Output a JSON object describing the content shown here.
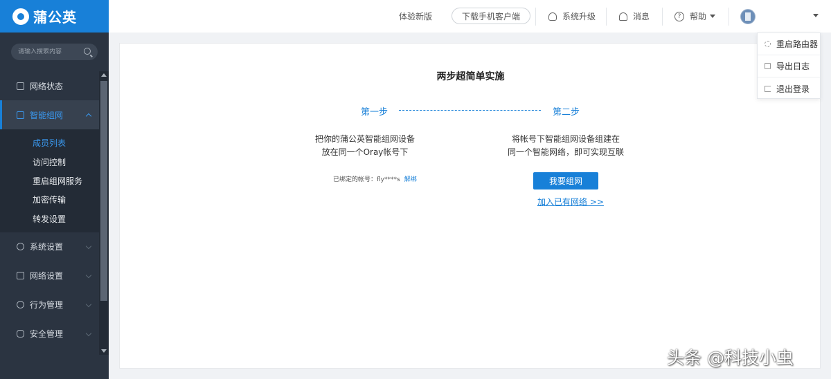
{
  "sidebar": {
    "logo_text": "蒲公英",
    "search_placeholder": "请输入搜索内容",
    "nav": [
      {
        "label": "网络状态",
        "icon": "network-status-icon"
      },
      {
        "label": "智能组网",
        "icon": "smart-network-icon",
        "active": true
      },
      {
        "label": "系统设置",
        "icon": "gear-icon"
      },
      {
        "label": "网络设置",
        "icon": "network-settings-icon"
      },
      {
        "label": "行为管理",
        "icon": "behavior-icon"
      },
      {
        "label": "安全管理",
        "icon": "security-icon"
      }
    ],
    "subnav": [
      "成员列表",
      "访问控制",
      "重启组网服务",
      "加密传输",
      "转发设置"
    ]
  },
  "header": {
    "new_version": "体验新版",
    "download_client": "下载手机客户端",
    "upgrade": "系统升级",
    "messages": "消息",
    "help": "帮助"
  },
  "dropdown": {
    "items": [
      "重启路由器",
      "导出日志",
      "退出登录"
    ]
  },
  "main": {
    "title": "两步超简单实施",
    "step1": "第一步",
    "step2": "第二步",
    "step1_line1": "把你的蒲公英智能组网设备",
    "step1_line2": "放在同一个Oray帐号下",
    "step2_line1": "将帐号下智能组网设备组建在",
    "step2_line2": "同一个智能网络，即可实现互联",
    "bound_label": "已绑定的帐号：fly****s",
    "unbind_link": "解绑",
    "create_button": "我要组网",
    "join_link": "加入已有网络 >>"
  },
  "watermark": "头条 @科技小虫",
  "colors": {
    "brand": "#1880d8",
    "sidebar_bg": "#2b3441"
  }
}
